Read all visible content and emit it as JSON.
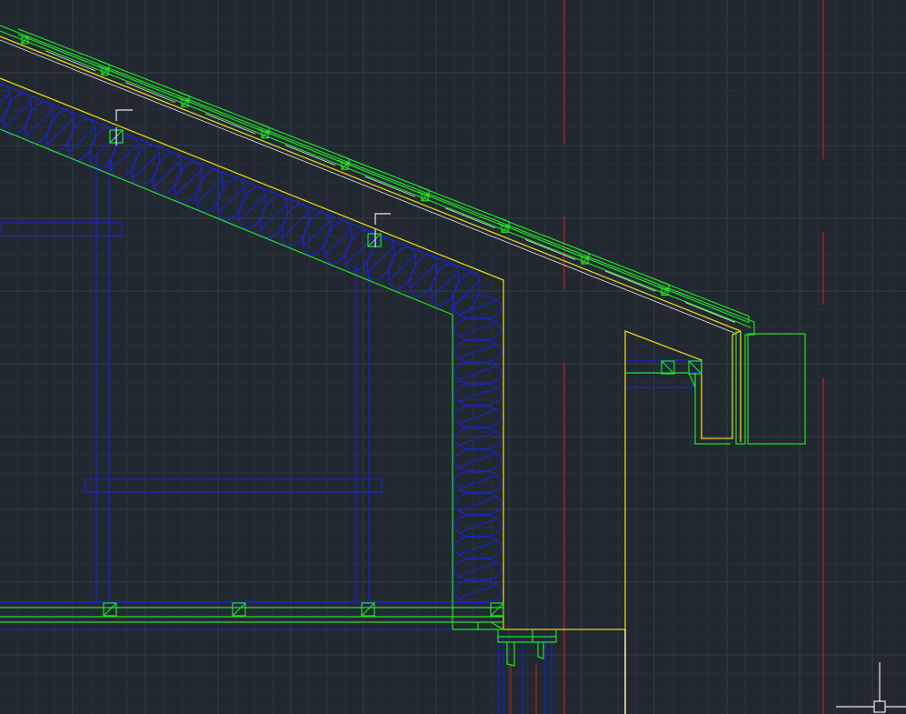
{
  "app": {
    "type": "cad-drawing-viewport"
  },
  "colors": {
    "background": "#212830",
    "grid_minor": "#2a323b",
    "grid_major": "#333c47",
    "layer_green": "#22e02a",
    "layer_blue": "#1a22d8",
    "layer_yellow": "#e6d21a",
    "layer_red": "#c0201a",
    "layer_white": "#e8e8e8"
  },
  "icons": {
    "crosshair": "ucs-crosshair-cursor",
    "grip": "pickbox-square"
  }
}
